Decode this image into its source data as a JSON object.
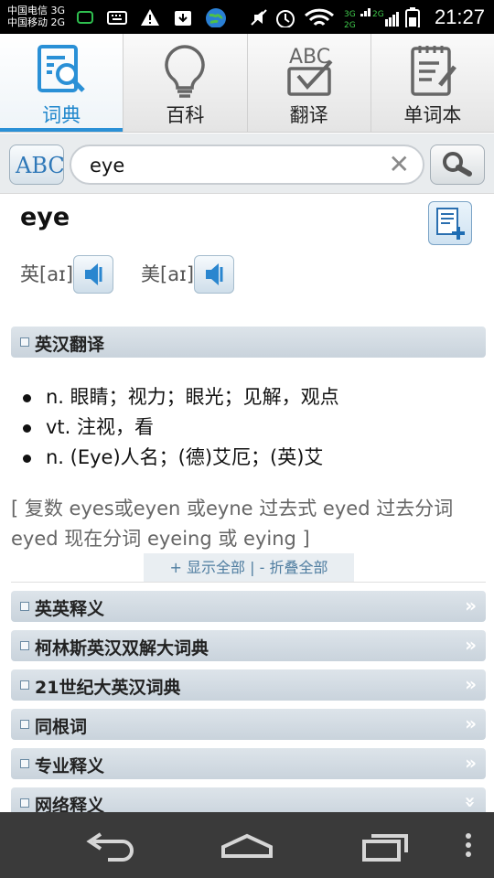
{
  "status_bar": {
    "carrier_1": "中国电信 3G",
    "carrier_2": "中国移动 2G",
    "time": "21:27",
    "icons": [
      "chat-icon",
      "keyboard-icon",
      "warning-icon",
      "download-icon",
      "globe-icon",
      "mute-icon",
      "alarm-icon",
      "wifi-icon",
      "signal-3g-icon",
      "signal-2g-icon",
      "battery-icon"
    ]
  },
  "tabs": [
    {
      "label": "词典",
      "icon": "dictionary-icon",
      "active": true
    },
    {
      "label": "百科",
      "icon": "lightbulb-icon",
      "active": false
    },
    {
      "label": "翻译",
      "icon": "abc-check-icon",
      "active": false
    },
    {
      "label": "单词本",
      "icon": "notebook-icon",
      "active": false
    }
  ],
  "search": {
    "value": "eye",
    "abc_button_label": "ABC"
  },
  "entry": {
    "word": "eye",
    "uk_label": "英[aɪ]",
    "us_label": "美[aɪ]"
  },
  "section_translation": {
    "title": "英汉翻译",
    "definitions": [
      "n. 眼睛；视力；眼光；见解，观点",
      "vt. 注视，看",
      "n. (Eye)人名；(德)艾厄；(英)艾"
    ],
    "word_forms": "[ 复数 eyes或eyen 或eyne   过去式 eyed   过去分词 eyed   现在分词 eyeing 或 eying   ]"
  },
  "fold_controls": {
    "show_all": "+ 显示全部",
    "separator": "|",
    "collapse_all": "- 折叠全部"
  },
  "sections": [
    {
      "title": "英英释义"
    },
    {
      "title": "柯林斯英汉双解大词典"
    },
    {
      "title": "21世纪大英汉词典"
    },
    {
      "title": "同根词"
    },
    {
      "title": "专业释义"
    },
    {
      "title": "网络释义"
    }
  ],
  "colors": {
    "accent": "#2a90d6",
    "section_bg": "#c9d3dc",
    "navbar_bg": "#3a3a3a"
  }
}
